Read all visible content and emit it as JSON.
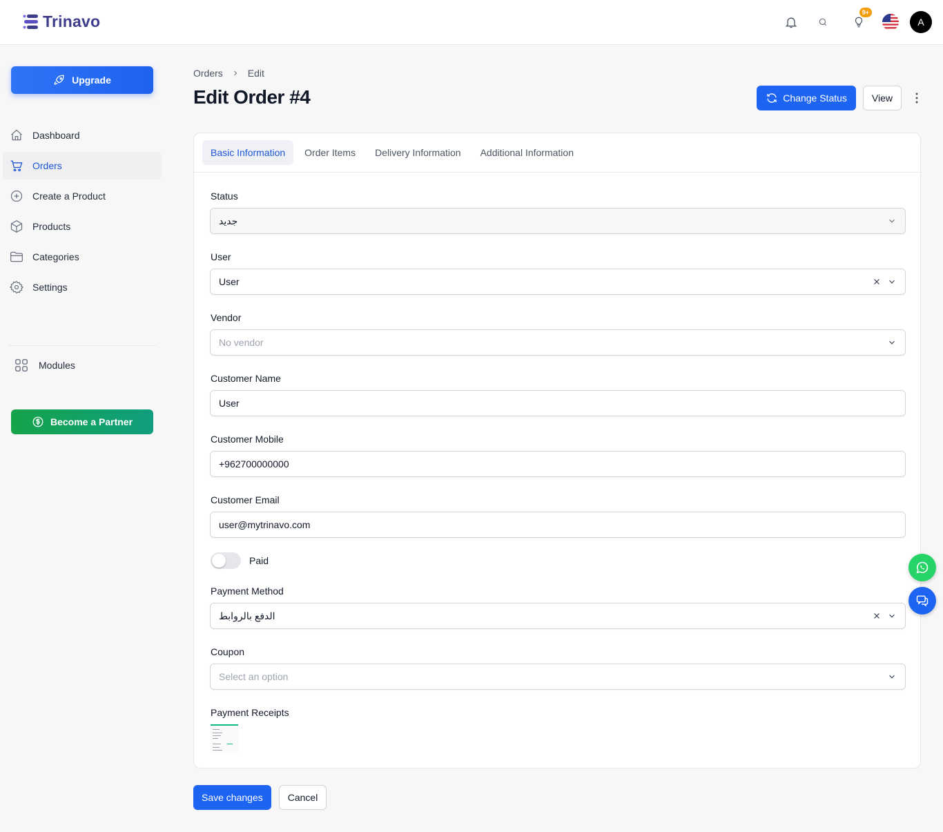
{
  "app": {
    "name": "Trinavo",
    "notification_badge": "9+",
    "avatar_initial": "A"
  },
  "colors": {
    "primary": "#1d64f2",
    "brand": "#3d3d8c",
    "partner": "#16a34a",
    "whatsapp": "#25d366",
    "badge": "#f59e0b"
  },
  "sidebar": {
    "upgrade_label": "Upgrade",
    "items": [
      {
        "label": "Dashboard",
        "icon": "home-icon",
        "active": false
      },
      {
        "label": "Orders",
        "icon": "cart-icon",
        "active": true
      },
      {
        "label": "Create a Product",
        "icon": "plus-circle-icon",
        "active": false
      },
      {
        "label": "Products",
        "icon": "box-icon",
        "active": false
      },
      {
        "label": "Categories",
        "icon": "folder-icon",
        "active": false
      },
      {
        "label": "Settings",
        "icon": "gear-icon",
        "active": false
      }
    ],
    "modules_label": "Modules",
    "partner_label": "Become a Partner"
  },
  "breadcrumb": {
    "parent": "Orders",
    "current": "Edit"
  },
  "page": {
    "title": "Edit Order #4",
    "change_status_label": "Change Status",
    "view_label": "View"
  },
  "tabs": [
    {
      "label": "Basic Information",
      "active": true
    },
    {
      "label": "Order Items",
      "active": false
    },
    {
      "label": "Delivery Information",
      "active": false
    },
    {
      "label": "Additional Information",
      "active": false
    }
  ],
  "form": {
    "status": {
      "label": "Status",
      "value": "جديد"
    },
    "user": {
      "label": "User",
      "value": "User"
    },
    "vendor": {
      "label": "Vendor",
      "placeholder": "No vendor"
    },
    "customer_name": {
      "label": "Customer Name",
      "value": "User"
    },
    "customer_mobile": {
      "label": "Customer Mobile",
      "value": "+962700000000"
    },
    "customer_email": {
      "label": "Customer Email",
      "value": "user@mytrinavo.com"
    },
    "paid": {
      "label": "Paid",
      "checked": false
    },
    "payment_method": {
      "label": "Payment Method",
      "value": "الدفع بالروابط"
    },
    "coupon": {
      "label": "Coupon",
      "placeholder": "Select an option"
    },
    "payment_receipts": {
      "label": "Payment Receipts"
    }
  },
  "footer": {
    "save_label": "Save changes",
    "cancel_label": "Cancel"
  }
}
